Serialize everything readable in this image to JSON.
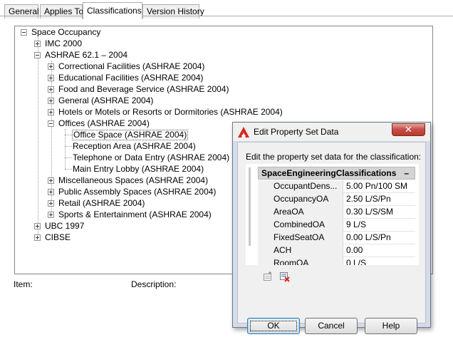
{
  "tabs": [
    {
      "label": "General",
      "active": false
    },
    {
      "label": "Applies To",
      "active": false
    },
    {
      "label": "Classifications",
      "active": true
    },
    {
      "label": "Version History",
      "active": false
    }
  ],
  "tree": {
    "root": "Space Occupancy",
    "imc": "IMC 2000",
    "ashrae": "ASHRAE 62.1 – 2004",
    "ashrae_children": [
      "Correctional Facilities (ASHRAE 2004)",
      "Educational Facilities (ASHRAE 2004)",
      "Food and Beverage Service (ASHRAE 2004)",
      "General (ASHRAE 2004)",
      "Hotels or Motels or Resorts or Dormitories (ASHRAE 2004)",
      "Offices (ASHRAE 2004)",
      "Miscellaneous Spaces (ASHRAE 2004)",
      "Public Assembly Spaces (ASHRAE 2004)",
      "Retail (ASHRAE 2004)",
      "Sports & Entertainment (ASHRAE 2004)"
    ],
    "offices_children": [
      "Office Space (ASHRAE 2004)",
      "Reception Area (ASHRAE 2004)",
      "Telephone or Data Entry (ASHRAE 2004)",
      "Main Entry Lobby (ASHRAE 2004)"
    ],
    "ubc": "UBC 1997",
    "cibse": "CIBSE"
  },
  "footer": {
    "item_label": "Item:",
    "description_label": "Description:"
  },
  "dialog": {
    "title": "Edit Property Set Data",
    "close": "✕",
    "prompt": "Edit the property set data for the classification:",
    "property_set": "SpaceEngineeringClassifications",
    "collapse": "–",
    "properties": [
      {
        "name": "OccupantDens...",
        "value": "5.00 Pn/100 SM"
      },
      {
        "name": "OccupancyOA",
        "value": "2.50  L/S/Pn"
      },
      {
        "name": "AreaOA",
        "value": "0.30 L/S/SM"
      },
      {
        "name": "CombinedOA",
        "value": "9 L/S"
      },
      {
        "name": "FixedSeatOA",
        "value": "0.00  L/S/Pn"
      },
      {
        "name": "ACH",
        "value": "0.00"
      },
      {
        "name": "RoomOA",
        "value": "0 L/S"
      }
    ],
    "buttons": {
      "ok": "OK",
      "cancel": "Cancel",
      "help": "Help"
    },
    "icons": {
      "add": "add-property-set-icon",
      "remove": "remove-property-set-icon",
      "app": "autocad-icon"
    }
  }
}
